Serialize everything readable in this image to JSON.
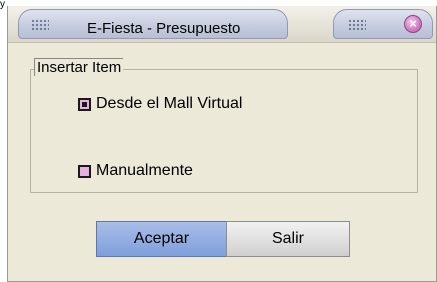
{
  "window": {
    "title": "E-Fiesta - Presupuesto",
    "close_glyph": "×"
  },
  "corner_glyph": "y",
  "group": {
    "label": "Insertar Item",
    "options": [
      {
        "label": "Desde el Mall Virtual",
        "checked": true
      },
      {
        "label": "Manualmente",
        "checked": false
      }
    ]
  },
  "buttons": {
    "accept": "Aceptar",
    "exit": "Salir"
  },
  "colors": {
    "window_bg": "#ece9d8",
    "accept_bg": "#8fa9e0",
    "radio_fill": "#e6b0e0"
  }
}
